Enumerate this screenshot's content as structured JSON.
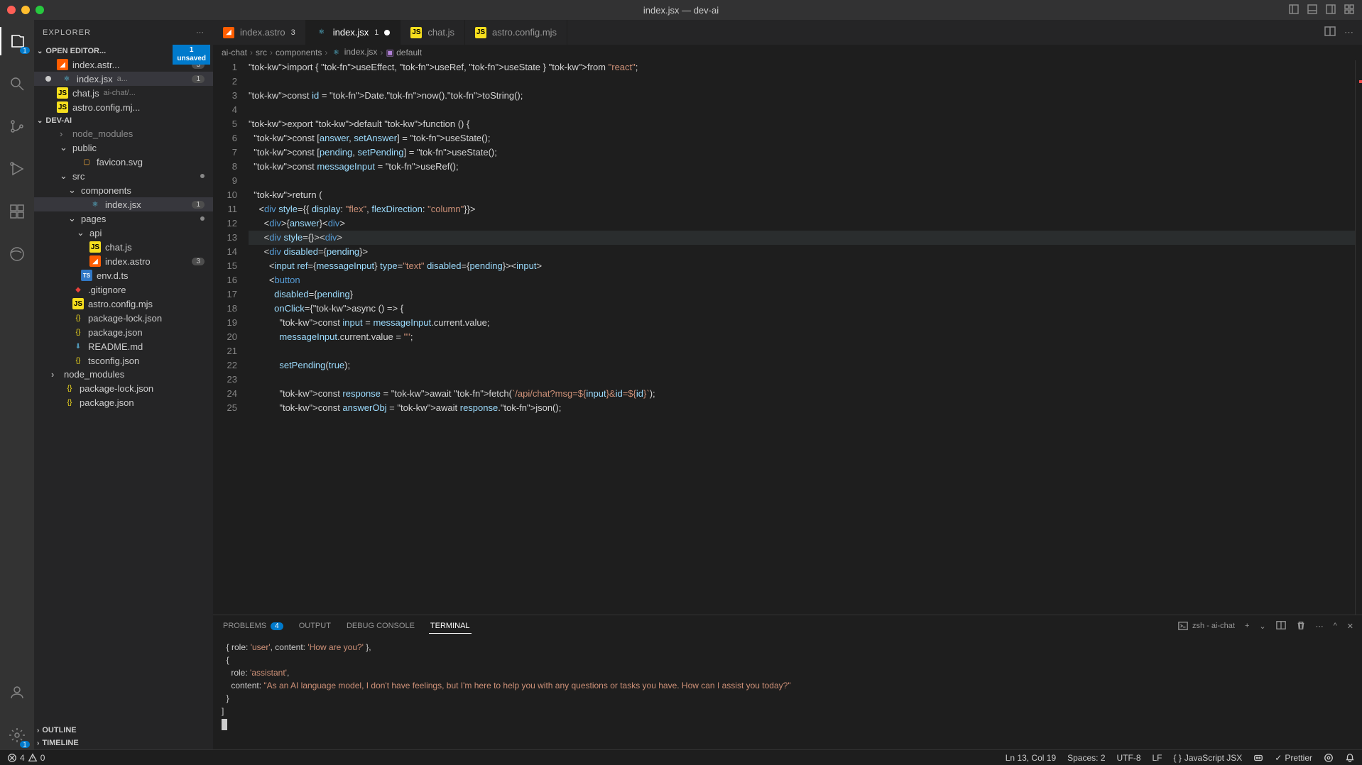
{
  "window": {
    "title": "index.jsx — dev-ai"
  },
  "activity": {
    "explorer_badge": "1",
    "settings_badge": "1"
  },
  "explorer": {
    "title": "EXPLORER",
    "open_editors": {
      "label": "OPEN EDITOR...",
      "unsaved_count": "1",
      "unsaved_label": "unsaved",
      "items": [
        {
          "name": "index.astr...",
          "badge": "3",
          "icon": "astro"
        },
        {
          "name": "index.jsx",
          "dim": "a...",
          "badge": "1",
          "modified": true,
          "icon": "react",
          "active": true
        },
        {
          "name": "chat.js",
          "dim": "ai-chat/...",
          "icon": "js"
        },
        {
          "name": "astro.config.mj...",
          "icon": "js"
        }
      ]
    },
    "project": {
      "label": "DEV-AI",
      "tree": [
        {
          "name": "node_modules",
          "type": "folder",
          "indent": 1,
          "dim": true
        },
        {
          "name": "public",
          "type": "folder",
          "indent": 1,
          "open": true
        },
        {
          "name": "favicon.svg",
          "type": "file",
          "icon": "svg",
          "indent": 2
        },
        {
          "name": "src",
          "type": "folder",
          "indent": 1,
          "open": true,
          "dot": true
        },
        {
          "name": "components",
          "type": "folder",
          "indent": 2,
          "open": true
        },
        {
          "name": "index.jsx",
          "type": "file",
          "icon": "react",
          "indent": 3,
          "active": true,
          "badge": "1"
        },
        {
          "name": "pages",
          "type": "folder",
          "indent": 2,
          "open": true,
          "dot": true
        },
        {
          "name": "api",
          "type": "folder",
          "indent": 3,
          "open": true
        },
        {
          "name": "chat.js",
          "type": "file",
          "icon": "js",
          "indent": 3
        },
        {
          "name": "index.astro",
          "type": "file",
          "icon": "astro",
          "indent": 3,
          "badge": "3"
        },
        {
          "name": "env.d.ts",
          "type": "file",
          "icon": "ts",
          "indent": 2
        },
        {
          "name": ".gitignore",
          "type": "file",
          "icon": "git",
          "indent": 1
        },
        {
          "name": "astro.config.mjs",
          "type": "file",
          "icon": "js",
          "indent": 1
        },
        {
          "name": "package-lock.json",
          "type": "file",
          "icon": "json",
          "indent": 1
        },
        {
          "name": "package.json",
          "type": "file",
          "icon": "json",
          "indent": 1
        },
        {
          "name": "README.md",
          "type": "file",
          "icon": "md",
          "indent": 1
        },
        {
          "name": "tsconfig.json",
          "type": "file",
          "icon": "json",
          "indent": 1
        },
        {
          "name": "node_modules",
          "type": "folder",
          "indent": 0
        },
        {
          "name": "package-lock.json",
          "type": "file",
          "icon": "json",
          "indent": 0
        },
        {
          "name": "package.json",
          "type": "file",
          "icon": "json",
          "indent": 0
        }
      ]
    },
    "outline": "OUTLINE",
    "timeline": "TIMELINE"
  },
  "tabs": [
    {
      "name": "index.astro",
      "icon": "astro",
      "badge": "3"
    },
    {
      "name": "index.jsx",
      "icon": "react",
      "badge": "1",
      "active": true,
      "modified": true
    },
    {
      "name": "chat.js",
      "icon": "js"
    },
    {
      "name": "astro.config.mjs",
      "icon": "js"
    }
  ],
  "breadcrumb": [
    "ai-chat",
    "src",
    "components",
    "index.jsx",
    "default"
  ],
  "code": {
    "lines": [
      "import { useEffect, useRef, useState } from \"react\";",
      "",
      "const id = Date.now().toString();",
      "",
      "export default function () {",
      "  const [answer, setAnswer] = useState();",
      "  const [pending, setPending] = useState();",
      "  const messageInput = useRef();",
      "",
      "  return (",
      "    <div style={{ display: \"flex\", flexDirection: \"column\"}}>",
      "      <div>{answer}</div>",
      "      <div style={}></div>",
      "      <div disabled={pending}>",
      "        <input ref={messageInput} type=\"text\" disabled={pending}></input>",
      "        <button",
      "          disabled={pending}",
      "          onClick={async () => {",
      "            const input = messageInput.current.value;",
      "            messageInput.current.value = \"\";",
      "",
      "            setPending(true);",
      "",
      "            const response = await fetch(`/api/chat?msg=${input}&id=${id}`);",
      "            const answerObj = await response.json();"
    ],
    "current_line": 13
  },
  "panel": {
    "tabs": {
      "problems": "PROBLEMS",
      "problems_count": "4",
      "output": "OUTPUT",
      "debug": "DEBUG CONSOLE",
      "terminal": "TERMINAL"
    },
    "terminal_label": "zsh - ai-chat",
    "terminal_lines": [
      "  { role: 'user', content: 'How are you?' },",
      "  {",
      "    role: 'assistant',",
      "    content: \"As an AI language model, I don't have feelings, but I'm here to help you with any questions or tasks you have. How can I assist you today?\"",
      "  }",
      "]"
    ]
  },
  "status": {
    "errors": "4",
    "warnings": "0",
    "line_col": "Ln 13, Col 19",
    "spaces": "Spaces: 2",
    "encoding": "UTF-8",
    "eol": "LF",
    "lang": "JavaScript JSX",
    "prettier": "Prettier"
  }
}
